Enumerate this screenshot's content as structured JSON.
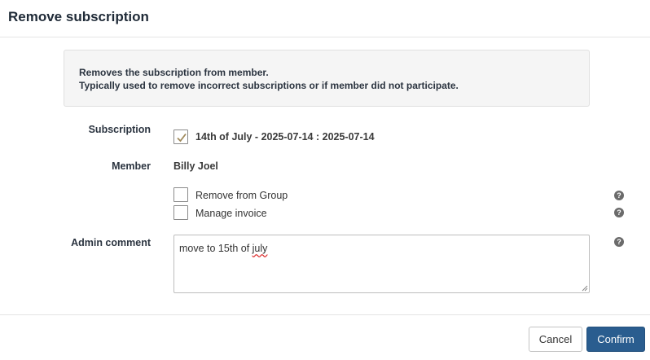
{
  "dialog": {
    "title": "Remove subscription"
  },
  "info": {
    "line1": "Removes the subscription from member.",
    "line2": "Typically used to remove incorrect subscriptions or if member did not participate."
  },
  "form": {
    "subscription_label": "Subscription",
    "subscription_value": "14th of July - 2025-07-14 : 2025-07-14",
    "subscription_checked": true,
    "member_label": "Member",
    "member_value": "Billy Joel",
    "remove_group_label": "Remove from Group",
    "remove_group_checked": false,
    "manage_invoice_label": "Manage invoice",
    "manage_invoice_checked": false,
    "admin_comment_label": "Admin comment",
    "admin_comment_text": "move to 15th of ",
    "admin_comment_misspelled": "july"
  },
  "help_icon_glyph": "?",
  "footer": {
    "cancel_label": "Cancel",
    "confirm_label": "Confirm"
  },
  "colors": {
    "primary": "#2a5d8f",
    "checkmark": "#a08a5c",
    "help_icon": "#6b6b6b"
  }
}
